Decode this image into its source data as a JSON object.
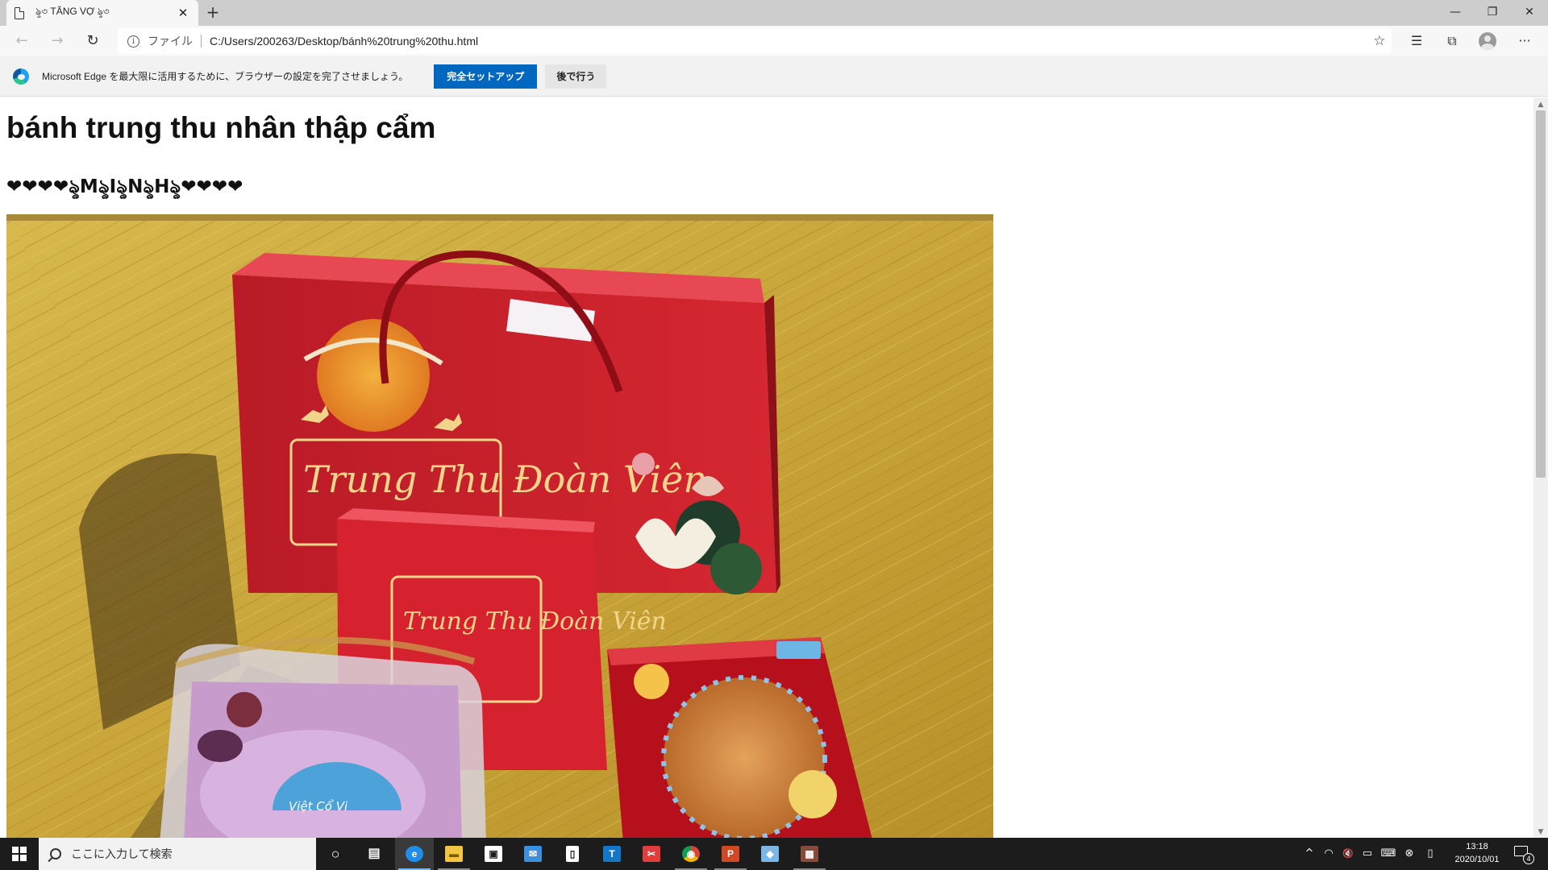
{
  "browser": {
    "tab": {
      "title": "ৡ৩ TĂNG VỢ ৡ৩",
      "close_glyph": "✕"
    },
    "new_tab_glyph": "+",
    "window_controls": {
      "minimize": "—",
      "maximize": "❐",
      "close": "✕"
    },
    "toolbar": {
      "back_glyph": "←",
      "forward_glyph": "→",
      "refresh_glyph": "↻",
      "scheme_label": "ファイル",
      "url": "C:/Users/200263/Desktop/bánh%20trung%20thu.html",
      "favorite_glyph": "☆",
      "favorites_glyph": "☰",
      "collections_glyph": "⧉",
      "menu_glyph": "···"
    },
    "infobar": {
      "message": "Microsoft Edge を最大限に活用するために、ブラウザーの設定を完了させましょう。",
      "primary_button": "完全セットアップ",
      "secondary_button": "後で行う"
    }
  },
  "page": {
    "heading": "bánh trung thu nhân thập cẩm",
    "subheading": "❤❤❤❤ৡMৡIৡNৡHৡ❤❤❤❤",
    "photo": {
      "box_text_large": "Trung Thu Đoàn Viên",
      "box_text_small": "Trung Thu Đoàn Viên",
      "label_text": "Việt Cổ Vi"
    }
  },
  "scrollbar": {
    "up_glyph": "▲",
    "down_glyph": "▼"
  },
  "taskbar": {
    "search_placeholder": "ここに入力して検索",
    "clock_time": "13:18",
    "clock_date": "2020/10/01",
    "notification_count": "4",
    "tray": {
      "chevron": "^",
      "wifi": "◠",
      "mute": "🔇",
      "battery": "▭",
      "keyboard": "⌨",
      "ime": "⊗",
      "note": "▯"
    },
    "apps": [
      {
        "name": "cortana",
        "glyph": "○"
      },
      {
        "name": "task-view",
        "glyph": "▤"
      },
      {
        "name": "edge",
        "glyph": "e",
        "color": "#1e8ee8"
      },
      {
        "name": "file-explorer",
        "glyph": "▬",
        "color": "#f4c542"
      },
      {
        "name": "store",
        "glyph": "▣",
        "color": "#ffffff"
      },
      {
        "name": "mail",
        "glyph": "✉",
        "color": "#3b8fe0"
      },
      {
        "name": "notepad",
        "glyph": "▯",
        "color": "#ffffff"
      },
      {
        "name": "teams-app",
        "glyph": "T",
        "color": "#1476c6"
      },
      {
        "name": "snipping-tool",
        "glyph": "✂",
        "color": "#e23d3d"
      },
      {
        "name": "chrome",
        "glyph": "◉",
        "color": "#e3b61d"
      },
      {
        "name": "powerpoint",
        "glyph": "P",
        "color": "#d24726"
      },
      {
        "name": "onenote-doc",
        "glyph": "◆",
        "color": "#7ab7e6"
      },
      {
        "name": "game-app",
        "glyph": "▦",
        "color": "#8a4a3a"
      }
    ]
  },
  "colors": {
    "accent": "#0067c0",
    "box_red": "#d6222e",
    "wood": "#c8a437",
    "taskbar": "#1c1c1c"
  }
}
